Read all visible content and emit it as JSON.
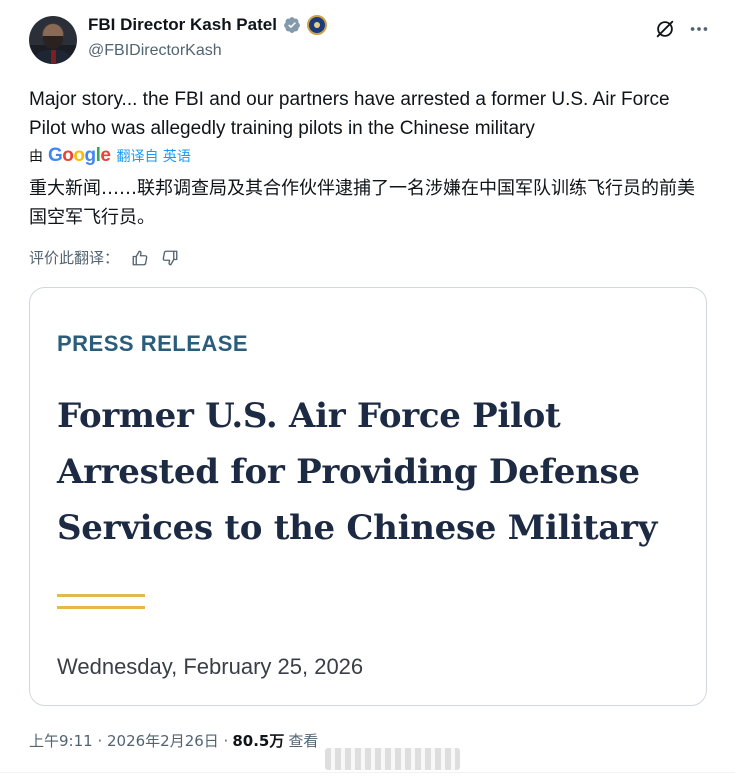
{
  "author": {
    "name": "FBI Director Kash Patel",
    "handle": "@FBIDirectorKash",
    "verified": true,
    "affiliate_badge": "seal-icon"
  },
  "header_actions": {
    "grok_icon": "grok-icon",
    "more_icon": "more-icon"
  },
  "tweet": {
    "text": "Major story... the FBI and our partners have arrested a former U.S. Air Force Pilot who was allegedly training pilots in the Chinese military",
    "translation_by": "由",
    "translation_provider": "Google",
    "translation_link": "翻译自 英语",
    "translated_text": "重大新闻……联邦调查局及其合作伙伴逮捕了一名涉嫌在中国军队训练飞行员的前美国空军飞行员。",
    "rate_translation_label": "评价此翻译："
  },
  "card": {
    "label": "PRESS RELEASE",
    "headline": "Former U.S. Air Force Pilot Arrested for Providing Defense Services to the Chinese Military",
    "date": "Wednesday, February 25, 2026"
  },
  "footer": {
    "time": "上午9:11 · 2026年2月26日 ·",
    "views": "80.5万",
    "views_label": "查看"
  },
  "colors": {
    "link": "#1d9bf0",
    "verified": "#829aab",
    "headline": "#1c2a44",
    "press_label": "#2a5d7a",
    "accent_gold": "#e2b94a"
  }
}
